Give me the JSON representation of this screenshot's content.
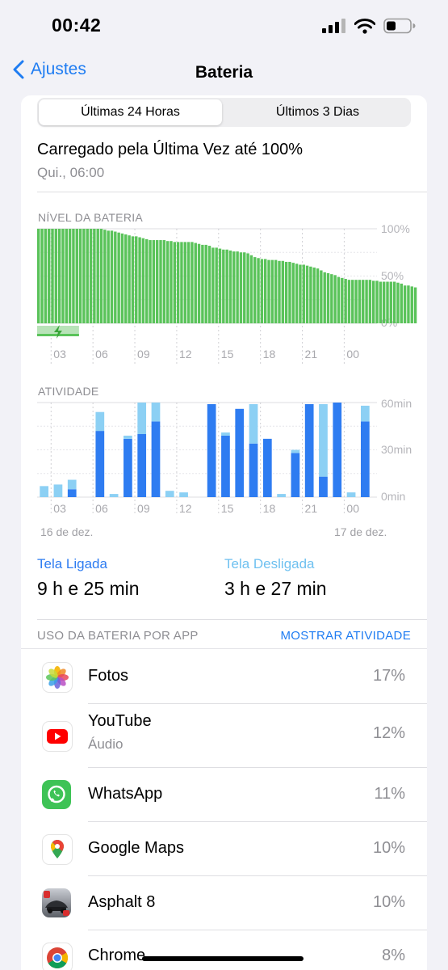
{
  "status_bar": {
    "time": "00:42"
  },
  "nav": {
    "back_label": "Ajustes",
    "title": "Bateria"
  },
  "segments": [
    {
      "label": "Últimas 24 Horas",
      "selected": true
    },
    {
      "label": "Últimos 3 Dias",
      "selected": false
    }
  ],
  "last_charge": {
    "title": "Carregado pela Última Vez até 100%",
    "subtitle": "Qui., 06:00"
  },
  "battery_chart": {
    "label": "NÍVEL DA BATERIA",
    "y_labels": [
      "100%",
      "50%",
      "0%"
    ],
    "x_labels": [
      "03",
      "06",
      "09",
      "12",
      "15",
      "18",
      "21",
      "00"
    ]
  },
  "activity_chart": {
    "label": "ATIVIDADE",
    "y_labels": [
      "60min",
      "30min",
      "0min"
    ],
    "x_labels": [
      "03",
      "06",
      "09",
      "12",
      "15",
      "18",
      "21",
      "00"
    ],
    "date_start": "16 de dez.",
    "date_end": "17 de dez."
  },
  "chart_data": [
    {
      "type": "bar",
      "title": "NÍVEL DA BATERIA",
      "x_tick_labels": [
        "03",
        "06",
        "09",
        "12",
        "15",
        "18",
        "21",
        "00"
      ],
      "ylim": [
        0,
        100
      ],
      "y_unit": "%",
      "bars_per_hour": 4,
      "start_hour": 2,
      "values": [
        100,
        100,
        100,
        100,
        100,
        100,
        100,
        100,
        100,
        100,
        100,
        100,
        100,
        100,
        100,
        100,
        100,
        100,
        100,
        99,
        98,
        98,
        97,
        96,
        95,
        94,
        93,
        92,
        92,
        91,
        90,
        89,
        88,
        88,
        88,
        88,
        88,
        87,
        87,
        86,
        86,
        86,
        86,
        86,
        86,
        85,
        84,
        83,
        83,
        82,
        80,
        80,
        79,
        78,
        78,
        77,
        76,
        76,
        75,
        75,
        74,
        72,
        70,
        69,
        68,
        68,
        67,
        67,
        67,
        66,
        66,
        65,
        65,
        64,
        63,
        62,
        62,
        61,
        60,
        59,
        58,
        56,
        54,
        53,
        52,
        51,
        49,
        48,
        47,
        46,
        46,
        46,
        46,
        46,
        46,
        46,
        45,
        45,
        44,
        44,
        44,
        44,
        44,
        43,
        42,
        40,
        40,
        39,
        38
      ],
      "charging_span_hours": [
        2,
        5
      ],
      "color": "#5ac35a"
    },
    {
      "type": "bar",
      "title": "ATIVIDADE",
      "x_tick_labels": [
        "03",
        "06",
        "09",
        "12",
        "15",
        "18",
        "21",
        "00"
      ],
      "ylim": [
        0,
        60
      ],
      "y_unit": "min",
      "start_hour": 2,
      "series": [
        {
          "name": "Tela Ligada",
          "values": [
            0,
            0,
            5,
            0,
            42,
            0,
            37,
            40,
            48,
            0,
            0,
            0,
            59,
            39,
            56,
            34,
            37,
            0,
            28,
            59,
            13,
            60,
            0,
            48,
            26
          ]
        },
        {
          "name": "Tela Desligada",
          "values": [
            7,
            8,
            6,
            0,
            12,
            2,
            2,
            20,
            12,
            4,
            3,
            0,
            0,
            2,
            0,
            25,
            0,
            2,
            2,
            0,
            46,
            0,
            3,
            10,
            10
          ]
        }
      ],
      "colors": [
        "#2e7cf1",
        "#8cd0f4"
      ]
    }
  ],
  "screen_stats": [
    {
      "label": "Tela Ligada",
      "value": "9 h e 25 min",
      "color": "#2e7cf1"
    },
    {
      "label": "Tela Desligada",
      "value": "3 h e 27 min",
      "color": "#6fc1f0"
    }
  ],
  "usage_header": {
    "label": "USO DA BATERIA POR APP",
    "action": "MOSTRAR ATIVIDADE"
  },
  "apps": [
    {
      "name": "Fotos",
      "subtitle": "",
      "percent": "17%",
      "icon": "photos-icon"
    },
    {
      "name": "YouTube",
      "subtitle": "Áudio",
      "percent": "12%",
      "icon": "youtube-icon"
    },
    {
      "name": "WhatsApp",
      "subtitle": "",
      "percent": "11%",
      "icon": "whatsapp-icon"
    },
    {
      "name": "Google Maps",
      "subtitle": "",
      "percent": "10%",
      "icon": "google-maps-icon"
    },
    {
      "name": "Asphalt 8",
      "subtitle": "",
      "percent": "10%",
      "icon": "asphalt-icon"
    },
    {
      "name": "Chrome",
      "subtitle": "",
      "percent": "8%",
      "icon": "chrome-icon"
    }
  ],
  "colors": {
    "accent": "#1e7cf2",
    "battery_green": "#5ac35a",
    "screen_on": "#2e7cf1",
    "screen_off": "#8cd0f4"
  }
}
